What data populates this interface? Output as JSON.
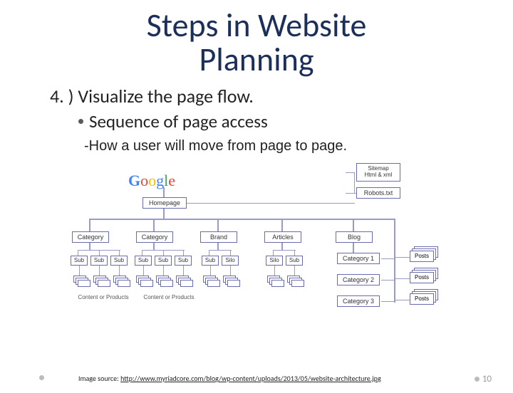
{
  "title_line1": "Steps in Website",
  "title_line2": "Planning",
  "main_point": "4. ) Visualize the page flow.",
  "bullet1": "Sequence of page access",
  "sub_point": "-How a user will move from page to page.",
  "diagram": {
    "logo": "Google",
    "sitemap_label": "Sitemap\nHtml & xml",
    "robots_label": "Robots.txt",
    "homepage": "Homepage",
    "categories": "Category",
    "brand": "Brand",
    "articles": "Articles",
    "blog": "Blog",
    "sub": "Sub",
    "silo": "Silo",
    "cat1": "Category 1",
    "cat2": "Category 2",
    "cat3": "Category 3",
    "posts": "Posts",
    "content_or_products": "Content or Products"
  },
  "caption_prefix": "Image source: ",
  "caption_url": "http://www.myriadcore.com/blog/wp-content/uploads/2013/05/website-architecture.jpg",
  "page_number": "10"
}
